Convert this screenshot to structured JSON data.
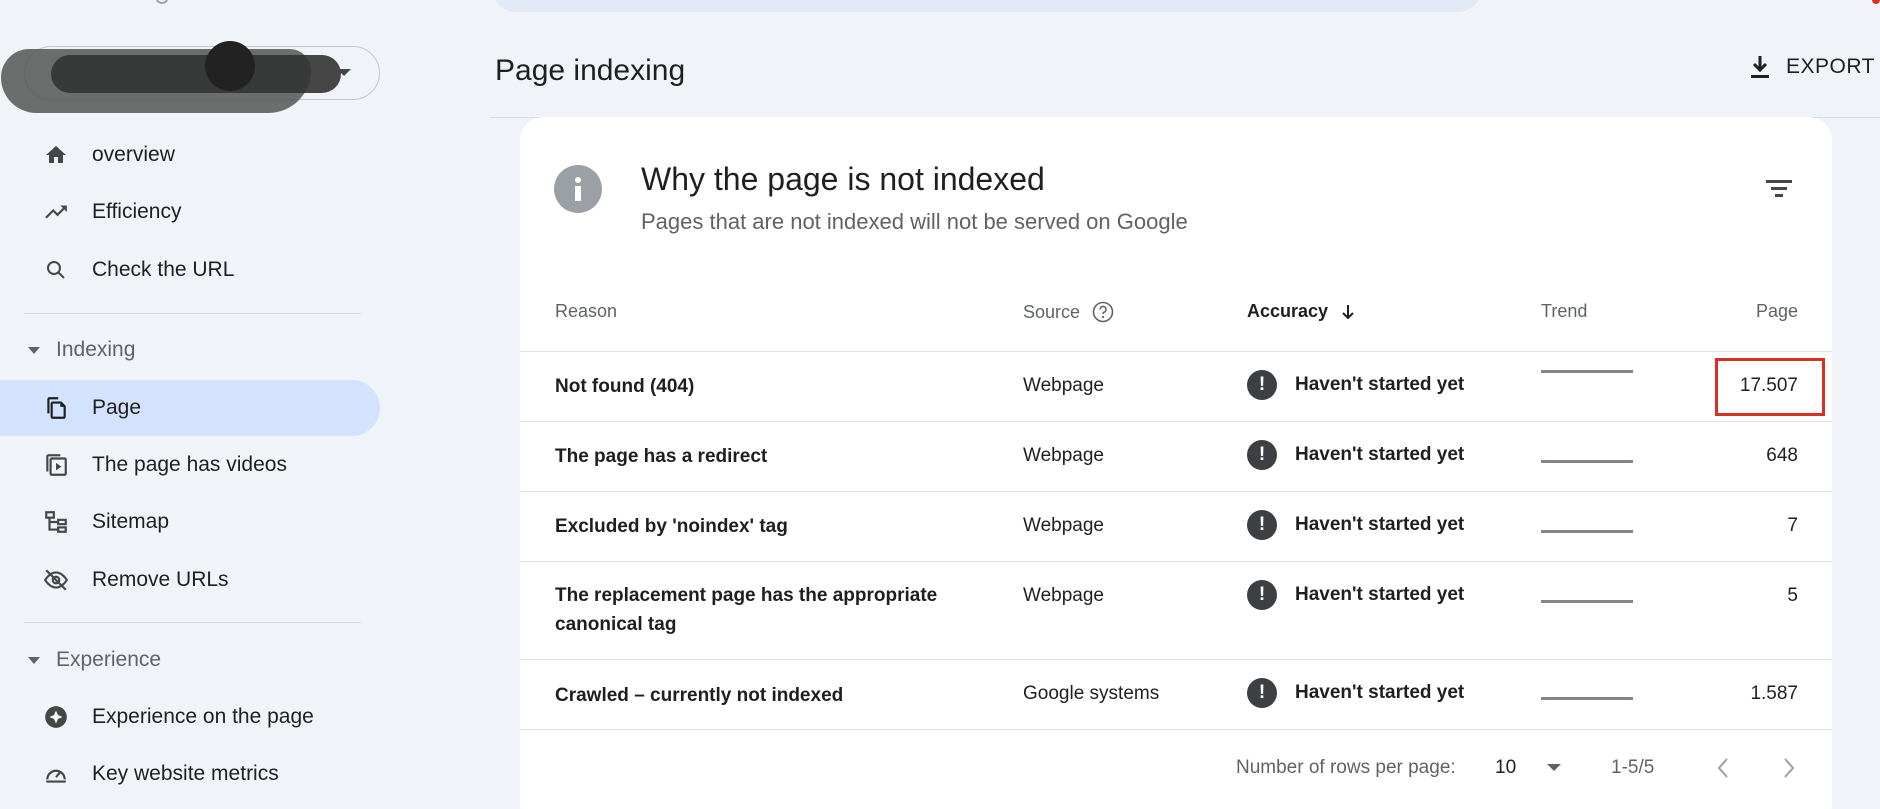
{
  "sidebar": {
    "items": [
      {
        "label": "overview",
        "icon": "home-icon"
      },
      {
        "label": "Efficiency",
        "icon": "trending-up-icon"
      },
      {
        "label": "Check the URL",
        "icon": "search-icon"
      }
    ],
    "sections": [
      {
        "label": "Indexing",
        "items": [
          {
            "label": "Page",
            "icon": "pages-icon",
            "active": true
          },
          {
            "label": "The page has videos",
            "icon": "video-page-icon"
          },
          {
            "label": "Sitemap",
            "icon": "sitemap-icon"
          },
          {
            "label": "Remove URLs",
            "icon": "eye-off-icon"
          }
        ]
      },
      {
        "label": "Experience",
        "items": [
          {
            "label": "Experience on the page",
            "icon": "experience-star-icon"
          },
          {
            "label": "Key website metrics",
            "icon": "speed-gauge-icon"
          }
        ]
      }
    ]
  },
  "header": {
    "title": "Page indexing",
    "export_label": "EXPORT"
  },
  "card": {
    "title": "Why the page is not indexed",
    "subtitle": "Pages that are not indexed will not be served on Google",
    "columns": [
      "Reason",
      "Source",
      "Accuracy",
      "Trend",
      "Page"
    ],
    "rows": [
      {
        "reason": "Not found (404)",
        "source": "Webpage",
        "accuracy": "Haven't started yet",
        "count": "17.507"
      },
      {
        "reason": "The page has a redirect",
        "source": "Webpage",
        "accuracy": "Haven't started yet",
        "count": "648"
      },
      {
        "reason": "Excluded by 'noindex' tag",
        "source": "Webpage",
        "accuracy": "Haven't started yet",
        "count": "7"
      },
      {
        "reason": "The replacement page has the appropriate canonical tag",
        "source": "Webpage",
        "accuracy": "Haven't started yet",
        "count": "5"
      },
      {
        "reason": "Crawled – currently not indexed",
        "source": "Google systems",
        "accuracy": "Haven't started yet",
        "count": "1.587"
      }
    ],
    "pagination": {
      "rows_per_page_label": "Number of rows per page:",
      "rows_per_page": "10",
      "range": "1-5/5"
    }
  },
  "colors": {
    "active_nav": "#d3e3fd",
    "highlight_box": "#d93025",
    "background": "#f0f4f9"
  }
}
